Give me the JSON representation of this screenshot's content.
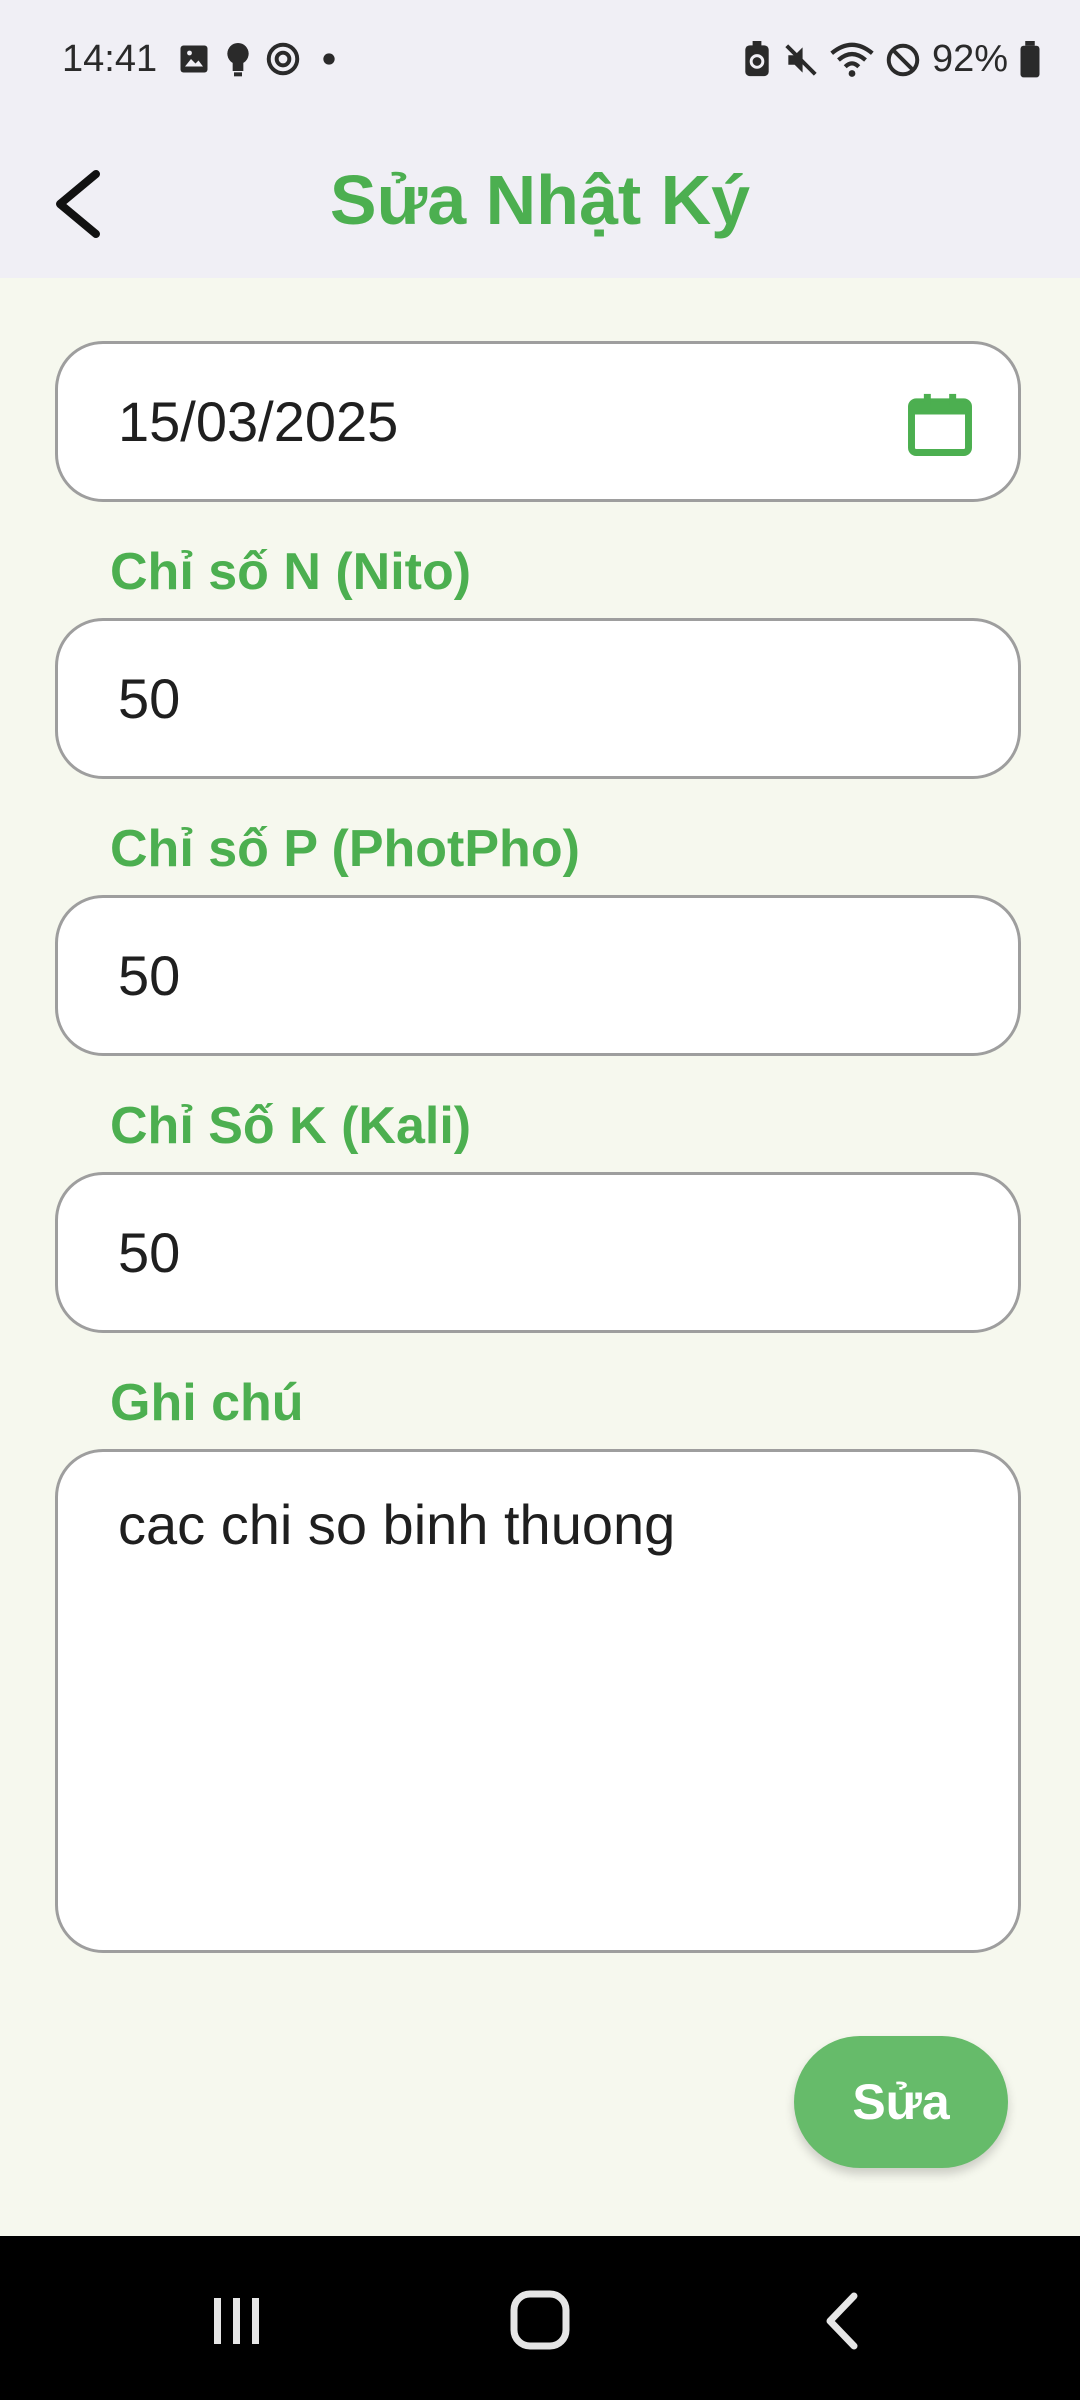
{
  "status_bar": {
    "time": "14:41",
    "battery_percent": "92%",
    "icons_left": [
      "image-icon",
      "bulb-icon",
      "focus-icon",
      "dot-icon"
    ],
    "icons_right": [
      "battery-saver-icon",
      "mute-icon",
      "wifi-icon",
      "do-not-disturb-icon",
      "battery-icon"
    ]
  },
  "header": {
    "title": "Sửa Nhật Ký",
    "back_icon": "chevron-left-icon"
  },
  "form": {
    "date_value": "15/03/2025",
    "date_icon": "calendar-icon",
    "n_label": "Chỉ số N (Nito)",
    "n_value": "50",
    "p_label": "Chỉ số P (PhotPho)",
    "p_value": "50",
    "k_label": "Chỉ Số K (Kali)",
    "k_value": "50",
    "note_label": "Ghi chú",
    "note_value": "cac chi so binh thuong",
    "submit_label": "Sửa"
  },
  "nav": {
    "recents_icon": "recents-icon",
    "home_icon": "home-icon",
    "back_icon": "back-icon"
  },
  "colors": {
    "accent": "#4CAF50",
    "button": "#66BB6A",
    "header_bg": "#F0EFF5",
    "page_bg": "#F6F8EE"
  }
}
